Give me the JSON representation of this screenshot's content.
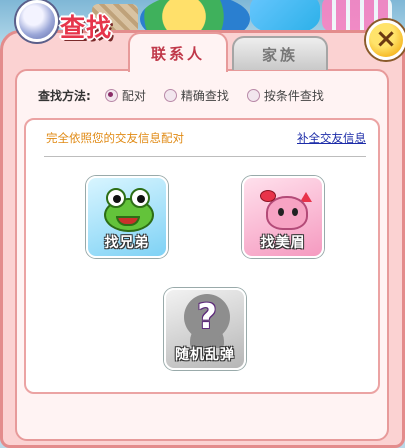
{
  "dialog": {
    "title": "查找",
    "close_label": "×"
  },
  "tabs": [
    {
      "label": "联系人",
      "active": true
    },
    {
      "label": "家族",
      "active": false
    }
  ],
  "search_method": {
    "label": "查找方法:",
    "options": [
      {
        "label": "配对",
        "selected": true
      },
      {
        "label": "精确查找",
        "selected": false
      },
      {
        "label": "按条件查找",
        "selected": false
      }
    ]
  },
  "panel": {
    "hint": "完全依照您的交友信息配对",
    "fill_link": "补全交友信息",
    "tiles": [
      {
        "label": "找兄弟",
        "icon": "frog-icon",
        "color": "#7fd2f5"
      },
      {
        "label": "找美眉",
        "icon": "dinosaur-icon",
        "color": "#f59ac0"
      },
      {
        "label": "随机乱弹",
        "icon": "question-icon",
        "color": "#b6b6b6"
      }
    ]
  },
  "colors": {
    "dialog_bg": "#fbd2d2",
    "border": "#e38c8c",
    "title": "#e6354b",
    "hint": "#e08a14",
    "link": "#1c2ca8"
  }
}
